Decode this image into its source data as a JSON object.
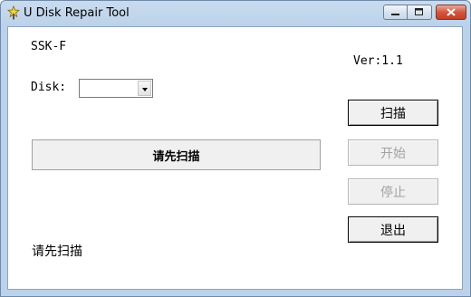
{
  "window": {
    "title": "U Disk Repair Tool"
  },
  "icons": {
    "app": "wand-icon",
    "minimize": "minimize-icon",
    "maximize": "maximize-icon",
    "close": "close-icon"
  },
  "main": {
    "device_name": "SSK-F",
    "version": "Ver:1.1",
    "disk_label": "Disk:",
    "disk_selected": "",
    "status_box_text": "请先扫描",
    "status_text": "请先扫描"
  },
  "buttons": {
    "scan": "扫描",
    "start": "开始",
    "stop": "停止",
    "exit": "退出"
  },
  "colors": {
    "titlebar": "#bcd2ea",
    "close_button": "#c33d26",
    "disabled_text": "#a2a2a2"
  }
}
